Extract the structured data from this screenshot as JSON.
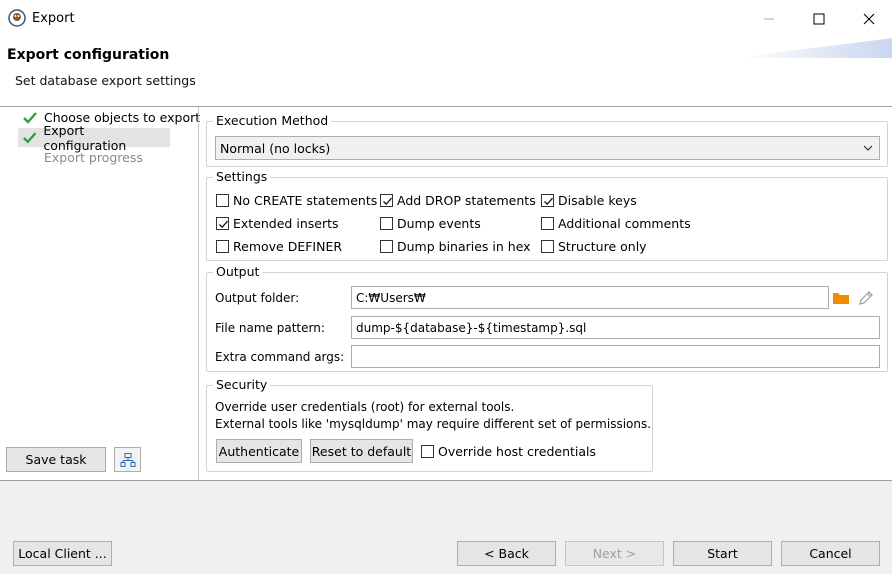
{
  "window": {
    "title": "Export"
  },
  "header": {
    "title": "Export configuration",
    "subtitle": "Set database export settings"
  },
  "nav": {
    "items": [
      {
        "label": "Choose objects to export",
        "done": true
      },
      {
        "label": "Export configuration",
        "done": true
      },
      {
        "label": "Export progress",
        "done": false
      }
    ]
  },
  "execution": {
    "title": "Execution Method",
    "selected": "Normal (no locks)"
  },
  "settings": {
    "title": "Settings",
    "options": [
      {
        "label": "No CREATE statements",
        "checked": false
      },
      {
        "label": "Add DROP statements",
        "checked": true
      },
      {
        "label": "Disable keys",
        "checked": true
      },
      {
        "label": "Extended inserts",
        "checked": true
      },
      {
        "label": "Dump events",
        "checked": false
      },
      {
        "label": "Additional comments",
        "checked": false
      },
      {
        "label": "Remove DEFINER",
        "checked": false
      },
      {
        "label": "Dump binaries in hex",
        "checked": false
      },
      {
        "label": "Structure only",
        "checked": false
      }
    ]
  },
  "output": {
    "title": "Output",
    "folder_label": "Output folder:",
    "folder_value": "C:₩Users₩",
    "pattern_label": "File name pattern:",
    "pattern_value": "dump-${database}-${timestamp}.sql",
    "extra_label": "Extra command args:",
    "extra_value": ""
  },
  "security": {
    "title": "Security",
    "line1": "Override user credentials (root) for external tools.",
    "line2": "External tools like 'mysqldump' may require different set of permissions.",
    "authenticate": "Authenticate",
    "reset": "Reset to default",
    "override_label": "Override host credentials",
    "override_checked": false
  },
  "left_actions": {
    "save_task": "Save task"
  },
  "footer": {
    "local_client": "Local Client ...",
    "back": "< Back",
    "next": "Next >",
    "start": "Start",
    "cancel": "Cancel"
  },
  "colors": {
    "accent_check": "#2e9e3f",
    "folder_orange": "#f08c00"
  }
}
